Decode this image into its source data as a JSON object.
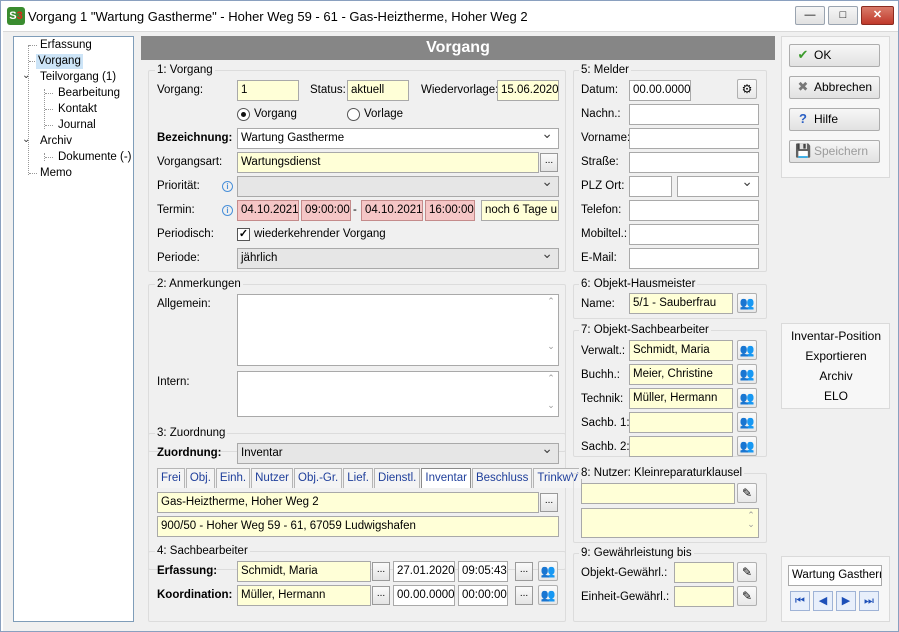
{
  "window": {
    "title": "Vorgang 1 \"Wartung Gastherme\" - Hoher Weg 59 - 61 - Gas-Heiztherme, Hoher Weg 2",
    "btn_min": "—",
    "btn_max": "□",
    "btn_close": "✕"
  },
  "tree": {
    "items": [
      "Erfassung",
      "Vorgang",
      "Teilvorgang (1)",
      "Bearbeitung",
      "Kontakt",
      "Journal",
      "Archiv",
      "Dokumente (-)",
      "Memo"
    ]
  },
  "header": {
    "title": "Vorgang"
  },
  "vorgang": {
    "group": "1: Vorgang",
    "vorgang_label": "Vorgang:",
    "vorgang_value": "1",
    "status_label": "Status:",
    "status_value": "aktuell",
    "wieder_label": "Wiedervorlage:",
    "wieder_value": "15.06.2020",
    "radio_vorgang": "Vorgang",
    "radio_vorlage": "Vorlage",
    "bez_label": "Bezeichnung:",
    "bez_value": "Wartung Gastherme",
    "art_label": "Vorgangsart:",
    "art_value": "Wartungsdienst",
    "prio_label": "Priorität:",
    "prio_value": "",
    "termin_label": "Termin:",
    "termin_date1": "04.10.2021",
    "termin_time1": "09:00:00",
    "termin_sep": "-",
    "termin_date2": "04.10.2021",
    "termin_time2": "16:00:00",
    "termin_rest": "noch 6 Tage u",
    "periodisch_label": "Periodisch:",
    "periodisch_text": "wiederkehrender Vorgang",
    "periode_label": "Periode:",
    "periode_value": "jährlich",
    "dots": "...",
    "check": "✓"
  },
  "anmerk": {
    "group": "2: Anmerkungen",
    "allgemein": "Allgemein:",
    "intern": "Intern:"
  },
  "zuordnung": {
    "group": "3: Zuordnung",
    "label": "Zuordnung:",
    "value": "Inventar",
    "tabs": [
      "Frei",
      "Obj.",
      "Einh.",
      "Nutzer",
      "Obj.-Gr.",
      "Lief.",
      "Dienstl.",
      "Inventar",
      "Beschluss",
      "TrinkwV"
    ],
    "active_tab": "Inventar",
    "line1": "Gas-Heiztherme, Hoher Weg 2",
    "line2": "900/50 - Hoher Weg 59 - 61, 67059 Ludwigshafen"
  },
  "sachb": {
    "group": "4: Sachbearbeiter",
    "erf_label": "Erfassung:",
    "erf_name": "Schmidt, Maria",
    "erf_date": "27.01.2020",
    "erf_time": "09:05:43",
    "koord_label": "Koordination:",
    "koord_name": "Müller, Hermann",
    "koord_date": "00.00.0000",
    "koord_time": "00:00:00"
  },
  "melder": {
    "group": "5: Melder",
    "datum_label": "Datum:",
    "datum_value": "00.00.0000",
    "nachn": "Nachn.:",
    "vorname": "Vorname:",
    "strasse": "Straße:",
    "plz": "PLZ Ort:",
    "telefon": "Telefon:",
    "mobil": "Mobiltel.:",
    "email": "E-Mail:"
  },
  "hausmeister": {
    "group": "6: Objekt-Hausmeister",
    "name_label": "Name:",
    "name_value": "5/1 - Sauberfrau"
  },
  "sachbearb": {
    "group": "7: Objekt-Sachbearbeiter",
    "verw_label": "Verwalt.:",
    "verw_value": "Schmidt, Maria",
    "buchh_label": "Buchh.:",
    "buchh_value": "Meier, Christine",
    "technik_label": "Technik:",
    "technik_value": "Müller, Hermann",
    "s1_label": "Sachb. 1:",
    "s2_label": "Sachb. 2:"
  },
  "nutzer": {
    "group": "8: Nutzer: Kleinreparaturklausel"
  },
  "gewaehr": {
    "group": "9: Gewährleistung bis",
    "objekt_label": "Objekt-Gewährl.:",
    "einheit_label": "Einheit-Gewährl.:"
  },
  "buttons": {
    "ok": "OK",
    "abbrechen": "Abbrechen",
    "hilfe": "Hilfe",
    "speichern": "Speichern"
  },
  "side": {
    "items": [
      "Inventar-Position",
      "Exportieren",
      "Archiv",
      "ELO"
    ]
  },
  "nav": {
    "field": "Wartung Gastherm",
    "first": "⏮",
    "prev": "◀",
    "next": "▶",
    "last": "⏭"
  }
}
